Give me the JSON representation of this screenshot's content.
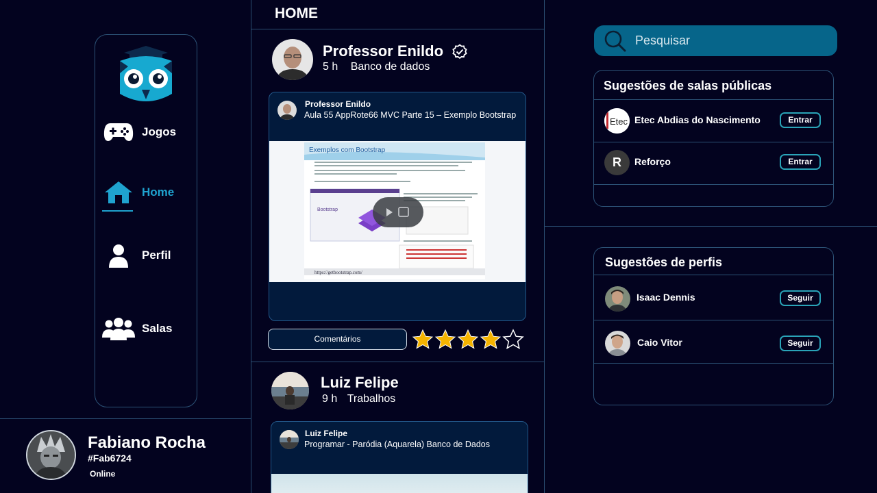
{
  "page": {
    "title": "HOME"
  },
  "sidebar": {
    "items": [
      {
        "label": "Jogos",
        "icon": "gamepad-icon"
      },
      {
        "label": "Home",
        "icon": "home-icon",
        "active": true
      },
      {
        "label": "Perfil",
        "icon": "user-icon"
      },
      {
        "label": "Salas",
        "icon": "group-icon"
      }
    ]
  },
  "current_user": {
    "name": "Fabiano Rocha",
    "tag": "#Fab6724",
    "status": "Online"
  },
  "posts": [
    {
      "author": "Professor Enildo",
      "time": "5 h",
      "room": "Banco de dados",
      "verified": true,
      "video": {
        "channel": "Professor Enildo",
        "title": "Aula 55 AppRote66 MVC Parte 15 – Exemplo Bootstrap",
        "slide_title": "Exemplos com Bootstrap",
        "slide_link": "https://getbootstrap.com/"
      },
      "comments_label": "Comentários",
      "rating": 4,
      "rating_max": 5
    },
    {
      "author": "Luiz Felipe",
      "time": "9 h",
      "room": "Trabalhos",
      "video": {
        "channel": "Luiz Felipe",
        "title": "Programar - Paródia (Aquarela) Banco de Dados"
      }
    }
  ],
  "search": {
    "placeholder": "Pesquisar"
  },
  "public_rooms": {
    "title": "Sugestões de salas públicas",
    "items": [
      {
        "name": "Etec Abdias do Nascimento",
        "button": "Entrar",
        "avatar_text": "Etec"
      },
      {
        "name": "Reforço",
        "button": "Entrar",
        "avatar_text": "R"
      }
    ]
  },
  "profiles": {
    "title": "Sugestões de perfis",
    "items": [
      {
        "name": "Isaac Dennis",
        "button": "Seguir"
      },
      {
        "name": "Caio Vitor",
        "button": "Seguir"
      }
    ]
  },
  "colors": {
    "background": "#03031f",
    "accent": "#1fa3cf",
    "search_bg": "#06658a",
    "card_bg": "#021a3c",
    "star": "#f5b400"
  }
}
